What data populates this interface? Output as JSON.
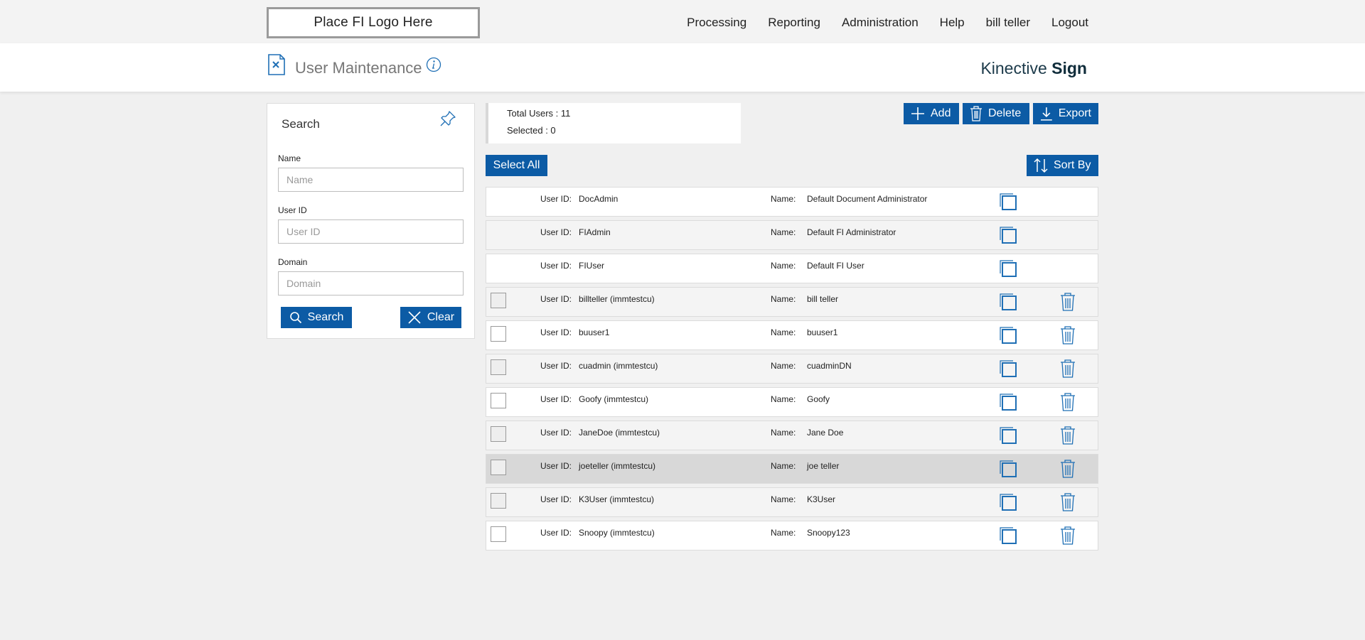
{
  "header": {
    "logo_text": "Place FI Logo Here",
    "nav": [
      "Processing",
      "Reporting",
      "Administration",
      "Help",
      "bill teller",
      "Logout"
    ]
  },
  "titlebar": {
    "page_title": "User Maintenance",
    "brand_prefix": "Kinective",
    "brand_bold": "Sign"
  },
  "search": {
    "title": "Search",
    "name_label": "Name",
    "name_placeholder": "Name",
    "userid_label": "User ID",
    "userid_placeholder": "User ID",
    "domain_label": "Domain",
    "domain_placeholder": "Domain",
    "search_button": "Search",
    "clear_button": "Clear"
  },
  "summary": {
    "total_users": "Total Users : 11",
    "selected": "Selected : 0"
  },
  "actions": {
    "add": "Add",
    "delete": "Delete",
    "export": "Export",
    "select_all": "Select All",
    "sort_by": "Sort By"
  },
  "labels": {
    "user_id": "User ID:",
    "name": "Name:"
  },
  "users": [
    {
      "user_id": "DocAdmin",
      "name": "Default Document Administrator",
      "selectable": false
    },
    {
      "user_id": "FIAdmin",
      "name": "Default FI Administrator",
      "selectable": false
    },
    {
      "user_id": "FIUser",
      "name": "Default FI User",
      "selectable": false
    },
    {
      "user_id": "billteller (immtestcu)",
      "name": "bill teller",
      "selectable": true
    },
    {
      "user_id": "buuser1",
      "name": "buuser1",
      "selectable": true
    },
    {
      "user_id": "cuadmin (immtestcu)",
      "name": "cuadminDN",
      "selectable": true
    },
    {
      "user_id": "Goofy (immtestcu)",
      "name": "Goofy",
      "selectable": true
    },
    {
      "user_id": "JaneDoe (immtestcu)",
      "name": "Jane Doe",
      "selectable": true
    },
    {
      "user_id": "joeteller (immtestcu)",
      "name": "joe teller",
      "selectable": true
    },
    {
      "user_id": "K3User (immtestcu)",
      "name": "K3User",
      "selectable": true
    },
    {
      "user_id": "Snoopy (immtestcu)",
      "name": "Snoopy123",
      "selectable": true
    }
  ],
  "colors": {
    "accent": "#0c5ba5",
    "icon_blue": "#1f6fb5",
    "highlight_row": "#d8d8d8"
  }
}
